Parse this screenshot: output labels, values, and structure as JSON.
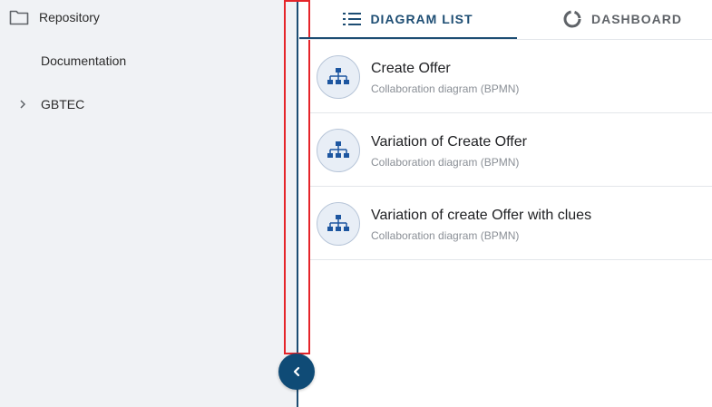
{
  "sidebar": {
    "items": [
      {
        "label": "Repository",
        "icon": "folder-icon"
      },
      {
        "label": "Documentation"
      },
      {
        "label": "GBTEC",
        "icon": "chevron-right-icon"
      }
    ]
  },
  "tabs": [
    {
      "label": "DIAGRAM LIST",
      "icon": "list-icon",
      "active": true
    },
    {
      "label": "DASHBOARD",
      "icon": "dashboard-icon",
      "active": false
    }
  ],
  "diagrams": [
    {
      "title": "Create Offer",
      "subtitle": "Collaboration diagram (BPMN)",
      "icon": "hierarchy-icon"
    },
    {
      "title": "Variation of Create Offer",
      "subtitle": "Collaboration diagram (BPMN)",
      "icon": "hierarchy-icon"
    },
    {
      "title": "Variation of create Offer with clues",
      "subtitle": "Collaboration diagram (BPMN)",
      "icon": "hierarchy-icon"
    }
  ],
  "colors": {
    "accent": "#1d4d73",
    "highlight": "#e5252a",
    "sidebar_bg": "#f0f2f5"
  }
}
